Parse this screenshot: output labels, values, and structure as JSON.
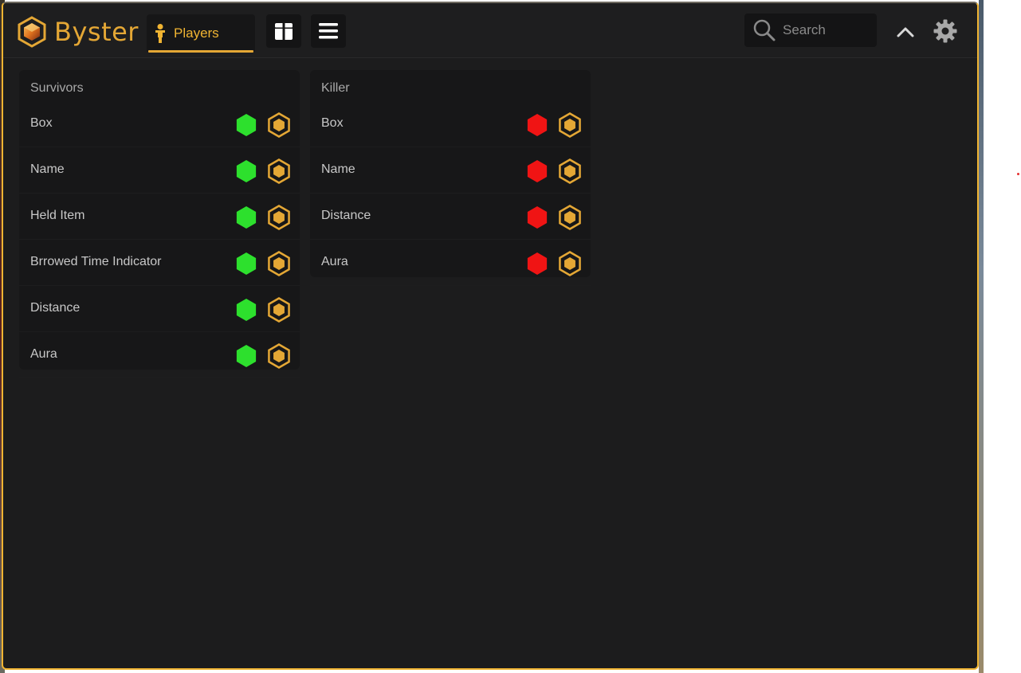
{
  "app": {
    "name": "Byster"
  },
  "colors": {
    "accent": "#e4a735",
    "enabled": "#2de02d",
    "disabled": "#f01414",
    "background": "#1c1c1d"
  },
  "toolbar": {
    "tabs": [
      {
        "label": "Players",
        "icon": "person-icon",
        "active": true
      }
    ],
    "buttons": [
      {
        "icon": "package-icon"
      },
      {
        "icon": "menu-icon"
      }
    ],
    "search_placeholder": "Search",
    "collapse_icon": "chevron-up-icon",
    "settings_icon": "gear-icon"
  },
  "survivors": {
    "title": "Survivors",
    "rows": [
      {
        "label": "Box",
        "enabled": true
      },
      {
        "label": "Name",
        "enabled": true
      },
      {
        "label": "Held Item",
        "enabled": true
      },
      {
        "label": "Brrowed Time Indicator",
        "enabled": true
      },
      {
        "label": "Distance",
        "enabled": true
      },
      {
        "label": "Aura",
        "enabled": true
      }
    ]
  },
  "killer": {
    "title": "Killer",
    "rows": [
      {
        "label": "Box",
        "enabled": false
      },
      {
        "label": "Name",
        "enabled": false
      },
      {
        "label": "Distance",
        "enabled": false
      },
      {
        "label": "Aura",
        "enabled": false
      }
    ]
  }
}
